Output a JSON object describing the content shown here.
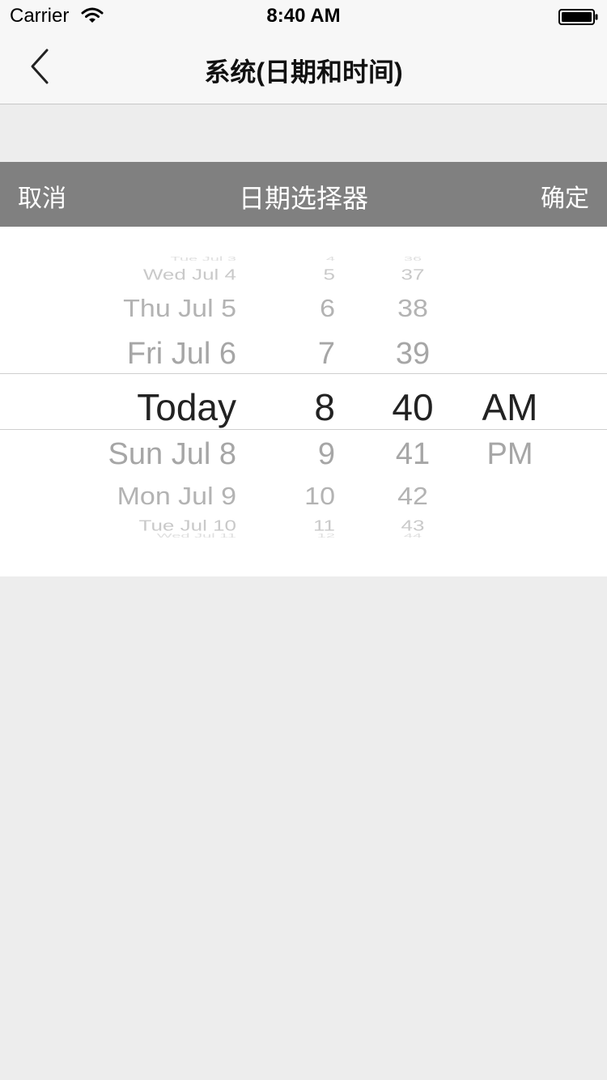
{
  "status_bar": {
    "carrier": "Carrier",
    "time": "8:40 AM"
  },
  "nav": {
    "title": "系统(日期和时间)",
    "back_icon": "chevron-left-icon"
  },
  "picker_bar": {
    "cancel_label": "取消",
    "title": "日期选择器",
    "confirm_label": "确定",
    "background": "#808080"
  },
  "picker": {
    "selected": {
      "date": "Today",
      "hour": "8",
      "minute": "40",
      "ampm": "AM"
    },
    "date_items": [
      "Tue Jul 3",
      "Wed Jul 4",
      "Thu Jul 5",
      "Fri Jul 6",
      "Today",
      "Sun Jul 8",
      "Mon Jul 9",
      "Tue Jul 10",
      "Wed Jul 11"
    ],
    "hour_items": [
      "4",
      "5",
      "6",
      "7",
      "8",
      "9",
      "10",
      "11",
      "12"
    ],
    "minute_items": [
      "36",
      "37",
      "38",
      "39",
      "40",
      "41",
      "42",
      "43",
      "44"
    ],
    "ampm_items": [
      "AM",
      "PM"
    ]
  },
  "colors": {
    "background": "#ededed",
    "selected_text": "#222222",
    "unselected_text": "#a6a6a6"
  }
}
